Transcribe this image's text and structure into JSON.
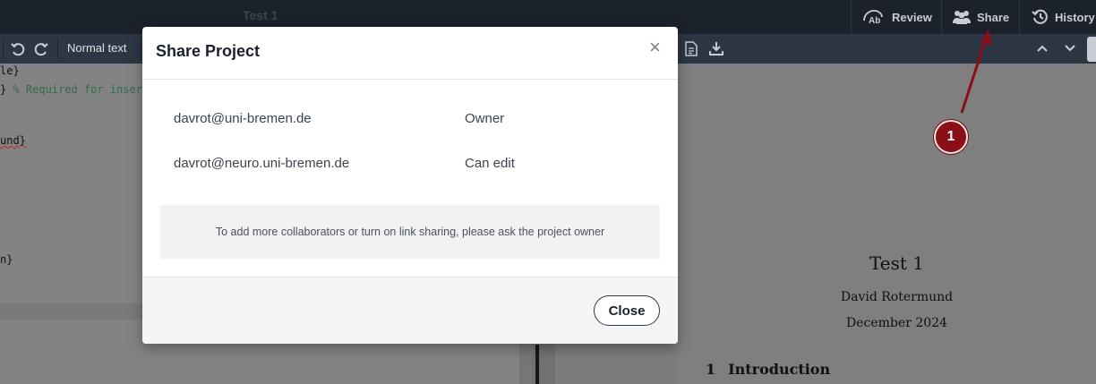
{
  "topbar": {
    "project_title": "Test 1",
    "review_label": "Review",
    "share_label": "Share",
    "history_label": "History"
  },
  "toolbar": {
    "text_style": "Normal text"
  },
  "editor": {
    "lines": [
      {
        "text": "le}"
      },
      {
        "text": "} ",
        "comment": "% Required for insert"
      },
      {
        "text": "und}"
      },
      {
        "text": "n}"
      }
    ]
  },
  "pdf": {
    "title": "Test 1",
    "author": "David Rotermund",
    "date": "December 2024",
    "section_number": "1",
    "section_title": "Introduction"
  },
  "callout": {
    "number": "1",
    "color": "#8a0f17"
  },
  "modal": {
    "title": "Share Project",
    "close_x": "×",
    "members": [
      {
        "email": "davrot@uni-bremen.de",
        "role": "Owner"
      },
      {
        "email": "davrot@neuro.uni-bremen.de",
        "role": "Can edit"
      }
    ],
    "notice": "To add more collaborators or turn on link sharing, please ask the project owner",
    "close_button": "Close"
  },
  "colors": {
    "topbar_bg": "#1b222c",
    "toolbar_bg": "#2c3645",
    "modal_bg": "#ffffff"
  }
}
